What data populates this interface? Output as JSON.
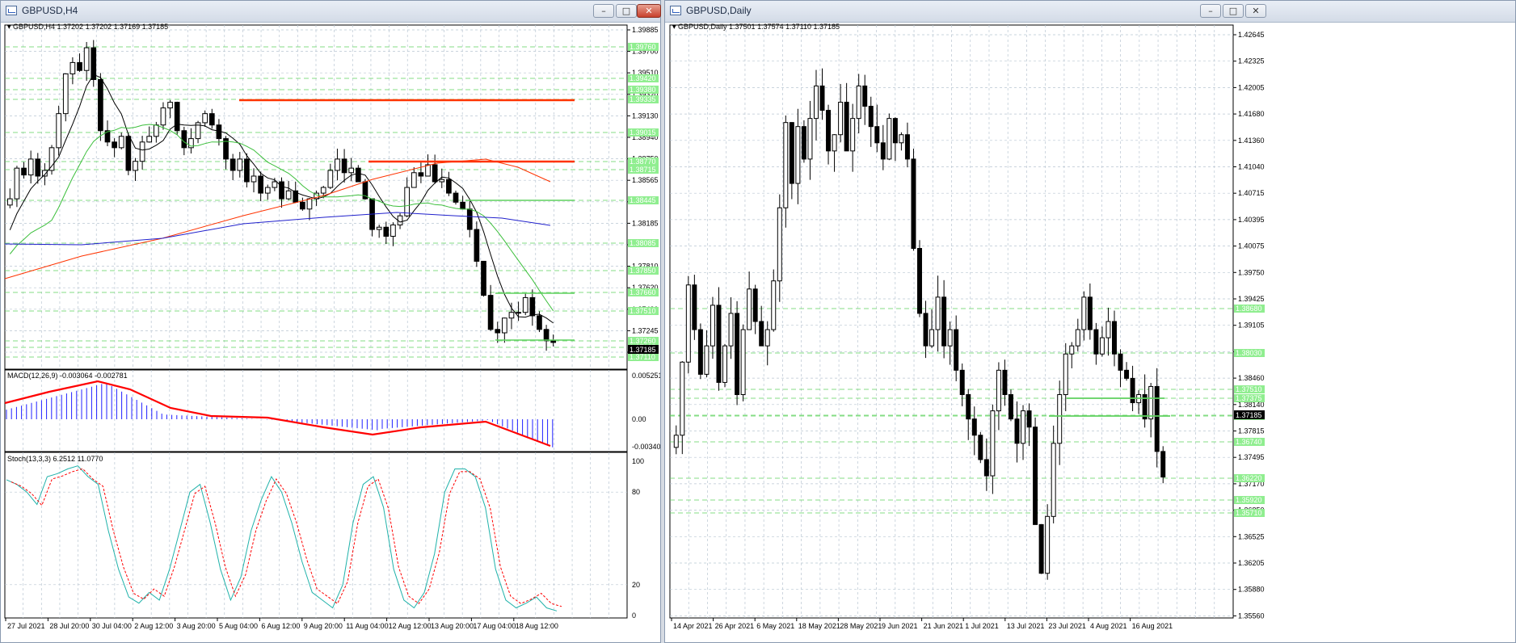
{
  "colors": {
    "grid": "#b9c6d2",
    "level": "#5ed15e",
    "level_fill": "#90ee90",
    "resistance": "#ff3300",
    "ma_black": "#000000",
    "ma_green": "#3cbf3c",
    "ma_red": "#ff3300",
    "ma_blue": "#2020cc",
    "macd_hist": "#2020ff",
    "macd_signal": "#ff0000",
    "stoch_main": "#20b2aa",
    "stoch_signal": "#ff0000"
  },
  "left_window": {
    "title": "GBPUSD,H4",
    "header": "GBPUSD,H4  1.37202 1.37202 1.37169 1.37185",
    "price_ticks": [
      "1.39885",
      "1.39700",
      "1.39510",
      "1.39320",
      "1.39130",
      "1.38940",
      "1.38750",
      "1.38565",
      "1.38375",
      "1.38185",
      "1.38000",
      "1.37810",
      "1.37620",
      "1.37430",
      "1.37245",
      "1.37055"
    ],
    "level_labels": [
      "1.39760",
      "1.39420",
      "1.39380",
      "1.39335",
      "1.39015",
      "1.38770",
      "1.38715",
      "1.38445",
      "1.38085",
      "1.37850",
      "1.37660",
      "1.37510",
      "1.37260",
      "1.37185",
      "1.37110"
    ],
    "current_price": "1.37185",
    "macd": {
      "label": "MACD(12,26,9) -0.003064 -0.002781",
      "ticks": [
        "0.005251",
        "0.00",
        "-0.003408"
      ]
    },
    "stoch": {
      "label": "Stoch(13,3,3) 6.2512 11.0770",
      "ticks": [
        "100",
        "80",
        "20",
        "0"
      ]
    },
    "x_labels": [
      "27 Jul 2021",
      "28 Jul 20:00",
      "30 Jul 04:00",
      "2 Aug 12:00",
      "3 Aug 20:00",
      "5 Aug 04:00",
      "6 Aug 12:00",
      "9 Aug 20:00",
      "11 Aug 04:00",
      "12 Aug 12:00",
      "13 Aug 20:00",
      "17 Aug 04:00",
      "18 Aug 12:00"
    ]
  },
  "right_window": {
    "title": "GBPUSD,Daily",
    "header": "GBPUSD,Daily  1.37501 1.37574 1.37110 1.37185",
    "price_ticks": [
      "1.42645",
      "1.42325",
      "1.42005",
      "1.41680",
      "1.41360",
      "1.41040",
      "1.40715",
      "1.40395",
      "1.40075",
      "1.39750",
      "1.39425",
      "1.39105",
      "1.38780",
      "1.38460",
      "1.38140",
      "1.37815",
      "1.37495",
      "1.37170",
      "1.36850",
      "1.36525",
      "1.36205",
      "1.35880",
      "1.35560"
    ],
    "level_labels": [
      "1.38680",
      "1.38030",
      "1.37510",
      "1.37375",
      "1.37185",
      "1.37180",
      "1.36740",
      "1.36220",
      "1.35920",
      "1.35710"
    ],
    "current_price": "1.37185",
    "x_labels": [
      "14 Apr 2021",
      "26 Apr 2021",
      "6 May 2021",
      "18 May 2021",
      "28 May 2021",
      "9 Jun 2021",
      "21 Jun 2021",
      "1 Jul 2021",
      "13 Jul 2021",
      "23 Jul 2021",
      "4 Aug 2021",
      "16 Aug 2021"
    ]
  },
  "chart_data": [
    {
      "type": "candlestick",
      "title": "GBPUSD,H4",
      "ohlc_last": {
        "open": 1.37202,
        "high": 1.37202,
        "low": 1.37169,
        "close": 1.37185
      },
      "ylim": [
        1.3695,
        1.3998
      ],
      "close_path": [
        1.3845,
        1.3872,
        1.3866,
        1.388,
        1.3865,
        1.387,
        1.389,
        1.392,
        1.3955,
        1.3965,
        1.3958,
        1.3978,
        1.395,
        1.3905,
        1.3895,
        1.389,
        1.39,
        1.387,
        1.3878,
        1.3895,
        1.39,
        1.391,
        1.3925,
        1.393,
        1.3905,
        1.389,
        1.3898,
        1.3912,
        1.392,
        1.391,
        1.3898,
        1.388,
        1.387,
        1.388,
        1.386,
        1.3865,
        1.385,
        1.3855,
        1.386,
        1.3845,
        1.3852,
        1.3842,
        1.3836,
        1.3845,
        1.385,
        1.3855,
        1.387,
        1.388,
        1.3868,
        1.3872,
        1.386,
        1.3845,
        1.3818,
        1.382,
        1.3812,
        1.3822,
        1.383,
        1.3855,
        1.3868,
        1.3865,
        1.3875,
        1.386,
        1.3862,
        1.385,
        1.3842,
        1.3836,
        1.3818,
        1.379,
        1.376,
        1.373,
        1.3727,
        1.374,
        1.3745,
        1.3745,
        1.3758,
        1.3742,
        1.373,
        1.372,
        1.37185
      ],
      "horizontal_levels": [
        {
          "price": 1.3934,
          "color": "red"
        },
        {
          "price": 1.3878,
          "color": "red"
        },
        {
          "price": 1.3845,
          "color": "green"
        },
        {
          "price": 1.3766,
          "color": "green"
        },
        {
          "price": 1.3726,
          "color": "green"
        }
      ]
    },
    {
      "type": "candlestick",
      "title": "GBPUSD,Daily",
      "ohlc_last": {
        "open": 1.37501,
        "high": 1.37574,
        "low": 1.3711,
        "close": 1.37185
      },
      "ylim": [
        1.3545,
        1.4275
      ],
      "close_path": [
        1.377,
        1.386,
        1.3955,
        1.39,
        1.3845,
        1.388,
        1.393,
        1.3835,
        1.388,
        1.392,
        1.382,
        1.39,
        1.395,
        1.391,
        1.388,
        1.39,
        1.396,
        1.405,
        1.4155,
        1.408,
        1.415,
        1.411,
        1.416,
        1.42,
        1.417,
        1.412,
        1.414,
        1.418,
        1.412,
        1.416,
        1.42,
        1.4175,
        1.415,
        1.413,
        1.411,
        1.416,
        1.413,
        1.414,
        1.411,
        1.4,
        1.392,
        1.388,
        1.39,
        1.394,
        1.388,
        1.39,
        1.385,
        1.382,
        1.379,
        1.377,
        1.374,
        1.372,
        1.38,
        1.385,
        1.382,
        1.379,
        1.376,
        1.38,
        1.378,
        1.366,
        1.36,
        1.367,
        1.376,
        1.382,
        1.387,
        1.388,
        1.39,
        1.394,
        1.39,
        1.387,
        1.389,
        1.391,
        1.387,
        1.385,
        1.384,
        1.381,
        1.382,
        1.379,
        1.383,
        1.375,
        1.37185
      ],
      "horizontal_levels": [
        {
          "price": 1.37375,
          "color": "green"
        },
        {
          "price": 1.3718,
          "color": "green"
        }
      ]
    }
  ]
}
